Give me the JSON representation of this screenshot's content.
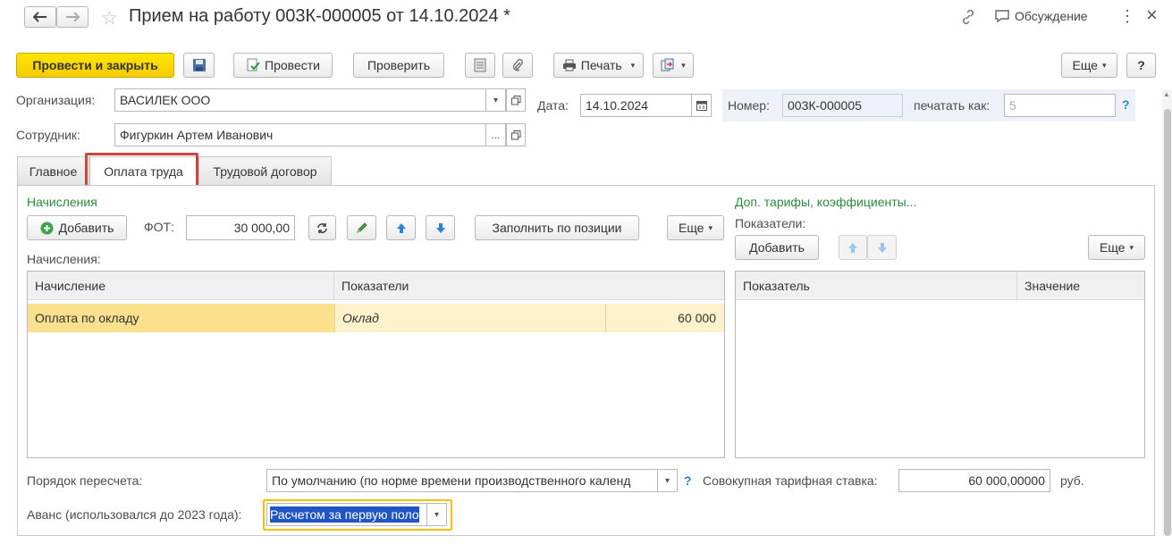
{
  "window": {
    "title": "Прием на работу 003К-000005 от 14.10.2024 *",
    "discussion_label": "Обсуждение",
    "more_icon": "⋮",
    "close_icon": "×"
  },
  "toolbar": {
    "post_close": "Провести и закрыть",
    "post": "Провести",
    "check": "Проверить",
    "print": "Печать",
    "more": "Еще",
    "help": "?"
  },
  "header": {
    "org_label": "Организация:",
    "org_value": "ВАСИЛЕК ООО",
    "date_label": "Дата:",
    "date_value": "14.10.2024",
    "number_label": "Номер:",
    "number_value": "003К-000005",
    "print_as_label": "печатать как:",
    "print_as_value": "5",
    "employee_label": "Сотрудник:",
    "employee_value": "Фигуркин Артем Иванович"
  },
  "tabs": [
    {
      "label": "Главное"
    },
    {
      "label": "Оплата труда"
    },
    {
      "label": "Трудовой договор"
    }
  ],
  "accruals": {
    "section_title": "Начисления",
    "add": "Добавить",
    "fot_label": "ФОТ:",
    "fot_value": "30 000,00",
    "fill_by_position": "Заполнить по позиции",
    "more": "Еще",
    "grid_label": "Начисления:",
    "columns": [
      "Начисление",
      "Показатели"
    ],
    "rows": [
      {
        "accrual": "Оплата по окладу",
        "indicator": "Оклад",
        "value": "60 000"
      }
    ]
  },
  "extra": {
    "section_title": "Доп. тарифы, коэффициенты...",
    "indicators_label": "Показатели:",
    "add": "Добавить",
    "more": "Еще",
    "columns": [
      "Показатель",
      "Значение"
    ]
  },
  "footer": {
    "recalc_label": "Порядок пересчета:",
    "recalc_value": "По умолчанию (по норме времени производственного календ",
    "rate_label": "Совокупная тарифная ставка:",
    "rate_value": "60 000,00000",
    "rate_unit": "руб.",
    "advance_label": "Аванс (использовался до 2023 года):",
    "advance_value": "Расчетом за первую поло"
  },
  "colors": {
    "primary": "#f5cc00",
    "row_highlight": "#fbe08d",
    "row_highlight_light": "#fdf2cc",
    "green": "#2b8a3e",
    "tab_active_border": "#d0453a",
    "focus_border": "#f2c200",
    "selection": "#2155c5"
  }
}
